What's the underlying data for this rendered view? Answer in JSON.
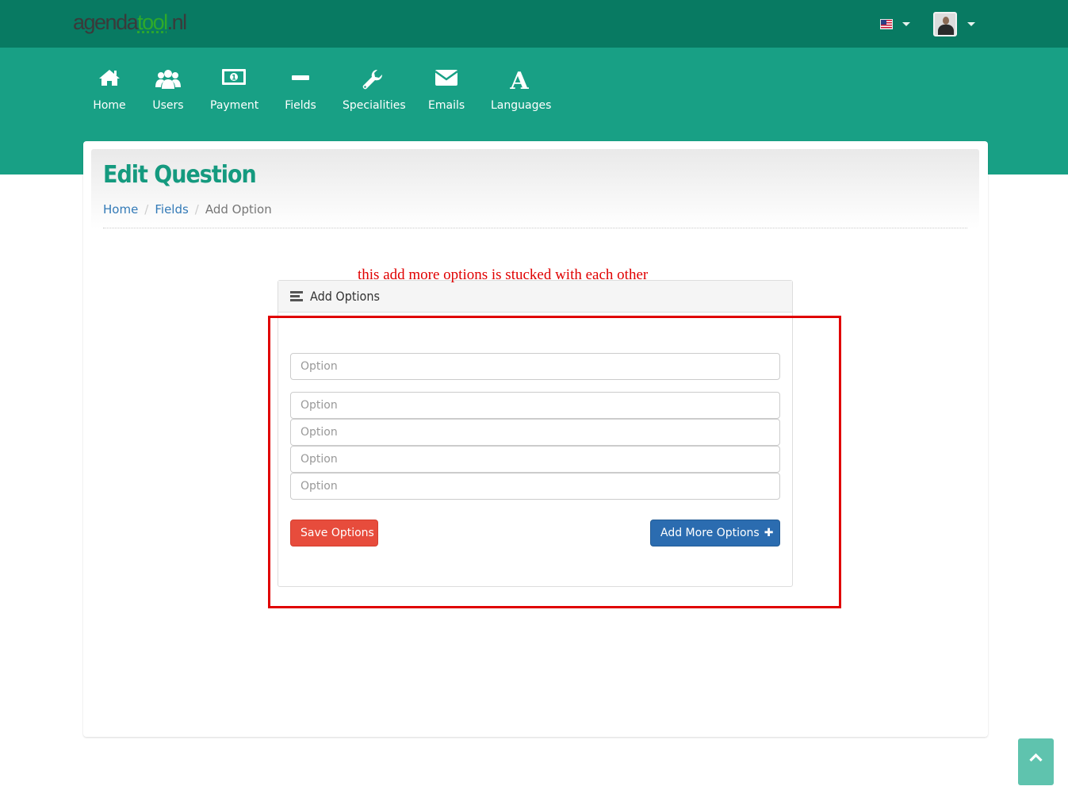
{
  "header": {
    "logo": {
      "part1": "agenda",
      "part2": "tool",
      "part3": ".nl"
    },
    "language_flag_icon": "us-flag-icon",
    "user_avatar_icon": "user-avatar-icon"
  },
  "nav": [
    {
      "label": "Home",
      "icon": "home-icon"
    },
    {
      "label": "Users",
      "icon": "users-icon"
    },
    {
      "label": "Payment",
      "icon": "money-icon"
    },
    {
      "label": "Fields",
      "icon": "minus-icon"
    },
    {
      "label": "Specialities",
      "icon": "wrench-icon"
    },
    {
      "label": "Emails",
      "icon": "envelope-icon"
    },
    {
      "label": "Languages",
      "icon": "font-icon"
    }
  ],
  "page": {
    "title": "Edit Question",
    "breadcrumb": [
      "Home",
      "Fields",
      "Add Option"
    ]
  },
  "panel": {
    "title": "Add Options",
    "options": [
      {
        "placeholder": "Option",
        "value": ""
      },
      {
        "placeholder": "Option",
        "value": ""
      },
      {
        "placeholder": "Option",
        "value": ""
      },
      {
        "placeholder": "Option",
        "value": ""
      },
      {
        "placeholder": "Option",
        "value": ""
      }
    ],
    "save_label": "Save Options",
    "add_more_label": "Add More Options"
  },
  "annotation": {
    "text": "this add more options is stucked with each other",
    "color": "#e00000"
  },
  "colors": {
    "topbar": "#087a62",
    "band": "#18a085",
    "title": "#159a7f",
    "danger": "#e74c3c",
    "primary": "#2b6cb0",
    "back_to_top": "#5fc3ae"
  }
}
